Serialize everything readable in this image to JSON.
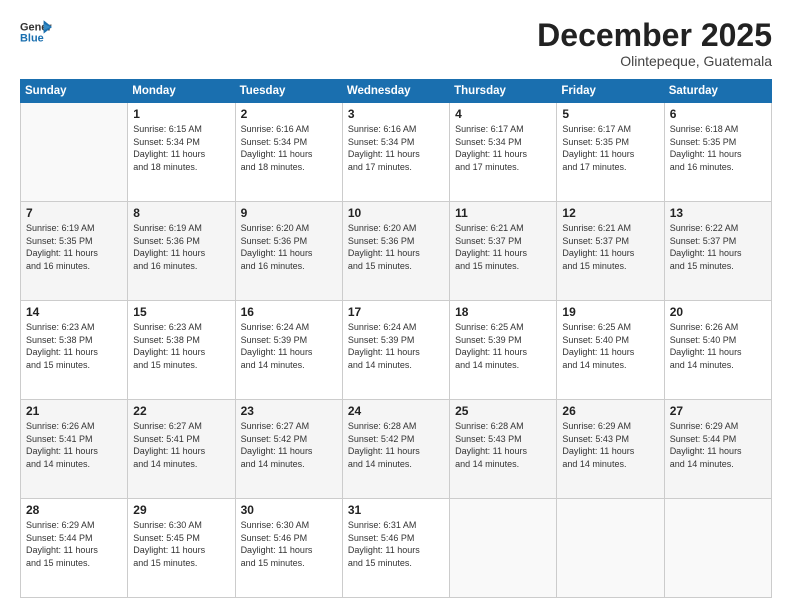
{
  "header": {
    "logo_line1": "General",
    "logo_line2": "Blue",
    "month": "December 2025",
    "location": "Olintepeque, Guatemala"
  },
  "weekdays": [
    "Sunday",
    "Monday",
    "Tuesday",
    "Wednesday",
    "Thursday",
    "Friday",
    "Saturday"
  ],
  "weeks": [
    [
      {
        "day": "",
        "text": ""
      },
      {
        "day": "1",
        "text": "Sunrise: 6:15 AM\nSunset: 5:34 PM\nDaylight: 11 hours\nand 18 minutes."
      },
      {
        "day": "2",
        "text": "Sunrise: 6:16 AM\nSunset: 5:34 PM\nDaylight: 11 hours\nand 18 minutes."
      },
      {
        "day": "3",
        "text": "Sunrise: 6:16 AM\nSunset: 5:34 PM\nDaylight: 11 hours\nand 17 minutes."
      },
      {
        "day": "4",
        "text": "Sunrise: 6:17 AM\nSunset: 5:34 PM\nDaylight: 11 hours\nand 17 minutes."
      },
      {
        "day": "5",
        "text": "Sunrise: 6:17 AM\nSunset: 5:35 PM\nDaylight: 11 hours\nand 17 minutes."
      },
      {
        "day": "6",
        "text": "Sunrise: 6:18 AM\nSunset: 5:35 PM\nDaylight: 11 hours\nand 16 minutes."
      }
    ],
    [
      {
        "day": "7",
        "text": "Sunrise: 6:19 AM\nSunset: 5:35 PM\nDaylight: 11 hours\nand 16 minutes."
      },
      {
        "day": "8",
        "text": "Sunrise: 6:19 AM\nSunset: 5:36 PM\nDaylight: 11 hours\nand 16 minutes."
      },
      {
        "day": "9",
        "text": "Sunrise: 6:20 AM\nSunset: 5:36 PM\nDaylight: 11 hours\nand 16 minutes."
      },
      {
        "day": "10",
        "text": "Sunrise: 6:20 AM\nSunset: 5:36 PM\nDaylight: 11 hours\nand 15 minutes."
      },
      {
        "day": "11",
        "text": "Sunrise: 6:21 AM\nSunset: 5:37 PM\nDaylight: 11 hours\nand 15 minutes."
      },
      {
        "day": "12",
        "text": "Sunrise: 6:21 AM\nSunset: 5:37 PM\nDaylight: 11 hours\nand 15 minutes."
      },
      {
        "day": "13",
        "text": "Sunrise: 6:22 AM\nSunset: 5:37 PM\nDaylight: 11 hours\nand 15 minutes."
      }
    ],
    [
      {
        "day": "14",
        "text": "Sunrise: 6:23 AM\nSunset: 5:38 PM\nDaylight: 11 hours\nand 15 minutes."
      },
      {
        "day": "15",
        "text": "Sunrise: 6:23 AM\nSunset: 5:38 PM\nDaylight: 11 hours\nand 15 minutes."
      },
      {
        "day": "16",
        "text": "Sunrise: 6:24 AM\nSunset: 5:39 PM\nDaylight: 11 hours\nand 14 minutes."
      },
      {
        "day": "17",
        "text": "Sunrise: 6:24 AM\nSunset: 5:39 PM\nDaylight: 11 hours\nand 14 minutes."
      },
      {
        "day": "18",
        "text": "Sunrise: 6:25 AM\nSunset: 5:39 PM\nDaylight: 11 hours\nand 14 minutes."
      },
      {
        "day": "19",
        "text": "Sunrise: 6:25 AM\nSunset: 5:40 PM\nDaylight: 11 hours\nand 14 minutes."
      },
      {
        "day": "20",
        "text": "Sunrise: 6:26 AM\nSunset: 5:40 PM\nDaylight: 11 hours\nand 14 minutes."
      }
    ],
    [
      {
        "day": "21",
        "text": "Sunrise: 6:26 AM\nSunset: 5:41 PM\nDaylight: 11 hours\nand 14 minutes."
      },
      {
        "day": "22",
        "text": "Sunrise: 6:27 AM\nSunset: 5:41 PM\nDaylight: 11 hours\nand 14 minutes."
      },
      {
        "day": "23",
        "text": "Sunrise: 6:27 AM\nSunset: 5:42 PM\nDaylight: 11 hours\nand 14 minutes."
      },
      {
        "day": "24",
        "text": "Sunrise: 6:28 AM\nSunset: 5:42 PM\nDaylight: 11 hours\nand 14 minutes."
      },
      {
        "day": "25",
        "text": "Sunrise: 6:28 AM\nSunset: 5:43 PM\nDaylight: 11 hours\nand 14 minutes."
      },
      {
        "day": "26",
        "text": "Sunrise: 6:29 AM\nSunset: 5:43 PM\nDaylight: 11 hours\nand 14 minutes."
      },
      {
        "day": "27",
        "text": "Sunrise: 6:29 AM\nSunset: 5:44 PM\nDaylight: 11 hours\nand 14 minutes."
      }
    ],
    [
      {
        "day": "28",
        "text": "Sunrise: 6:29 AM\nSunset: 5:44 PM\nDaylight: 11 hours\nand 15 minutes."
      },
      {
        "day": "29",
        "text": "Sunrise: 6:30 AM\nSunset: 5:45 PM\nDaylight: 11 hours\nand 15 minutes."
      },
      {
        "day": "30",
        "text": "Sunrise: 6:30 AM\nSunset: 5:46 PM\nDaylight: 11 hours\nand 15 minutes."
      },
      {
        "day": "31",
        "text": "Sunrise: 6:31 AM\nSunset: 5:46 PM\nDaylight: 11 hours\nand 15 minutes."
      },
      {
        "day": "",
        "text": ""
      },
      {
        "day": "",
        "text": ""
      },
      {
        "day": "",
        "text": ""
      }
    ]
  ]
}
